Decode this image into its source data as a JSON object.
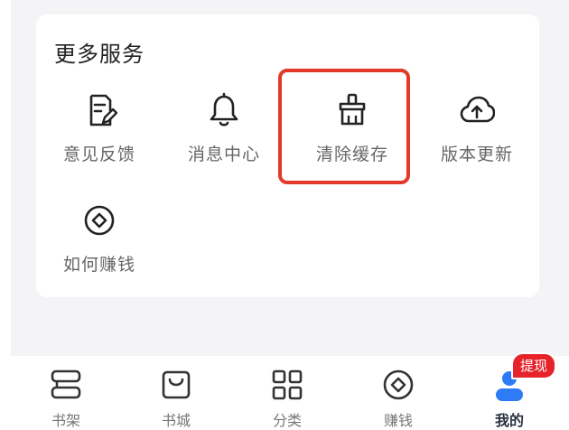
{
  "card": {
    "title": "更多服务"
  },
  "services": [
    {
      "label": "意见反馈",
      "icon": "feedback-edit-icon"
    },
    {
      "label": "消息中心",
      "icon": "bell-icon"
    },
    {
      "label": "清除缓存",
      "icon": "broom-icon"
    },
    {
      "label": "版本更新",
      "icon": "cloud-upload-icon"
    },
    {
      "label": "如何赚钱",
      "icon": "diamond-coin-icon"
    }
  ],
  "tabbar": {
    "tabs": [
      {
        "label": "书架",
        "icon": "bookshelf-icon"
      },
      {
        "label": "书城",
        "icon": "shopping-bag-icon"
      },
      {
        "label": "分类",
        "icon": "grid-icon"
      },
      {
        "label": "赚钱",
        "icon": "coin-icon"
      },
      {
        "label": "我的",
        "icon": "user-icon"
      }
    ],
    "active": "我的",
    "badge": "提现"
  },
  "colors": {
    "highlight": "#e23a28",
    "badge": "#e6232a",
    "active_icon": "#2f7bf5"
  }
}
